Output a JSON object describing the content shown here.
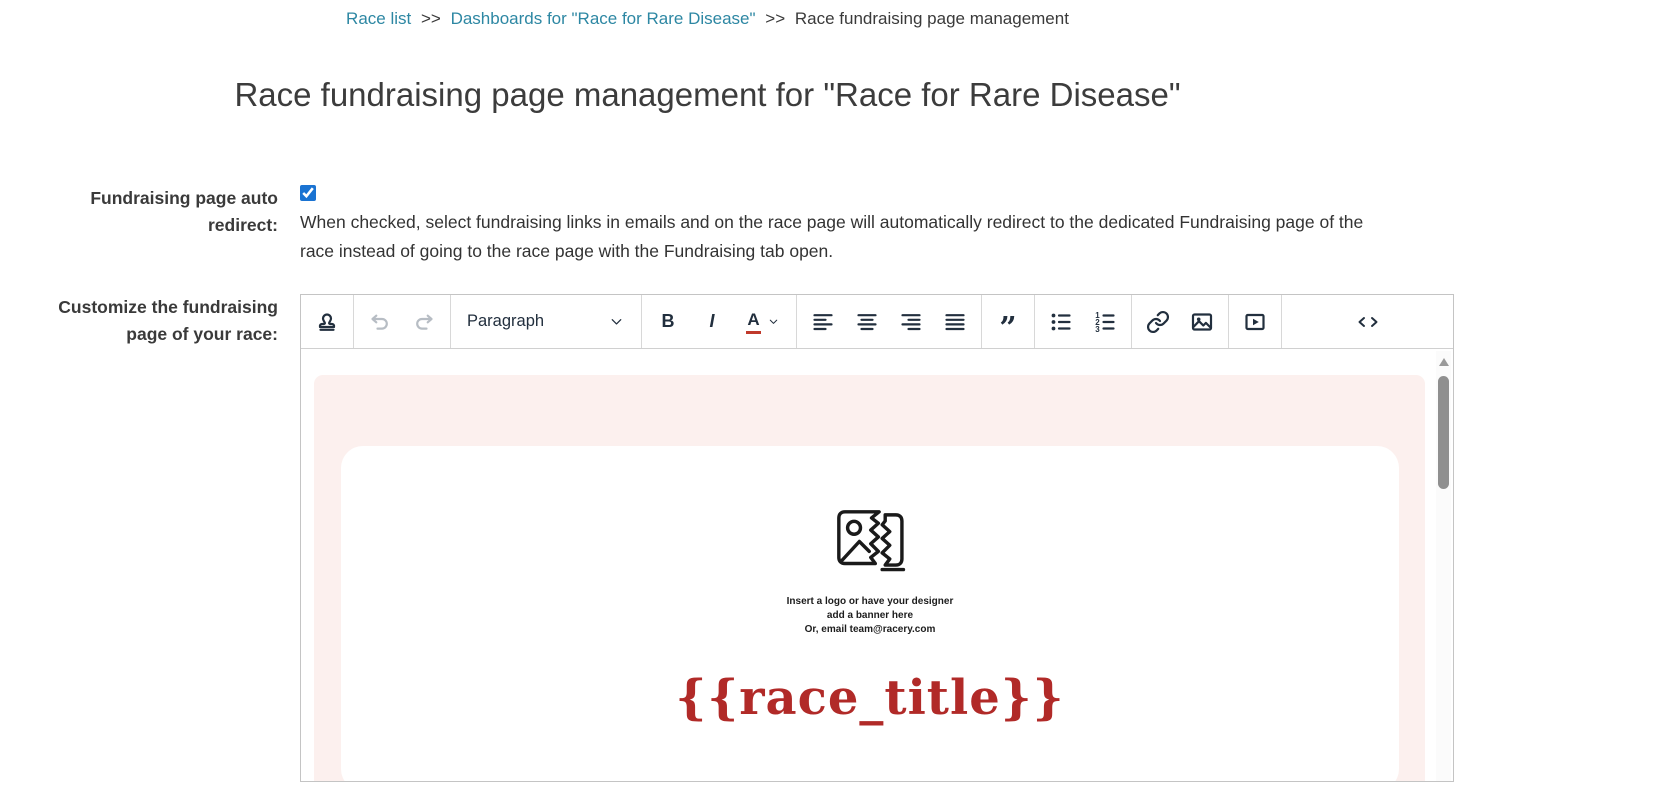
{
  "breadcrumb": {
    "separator": ">>",
    "items": [
      {
        "label": "Race list",
        "link": true
      },
      {
        "label": "Dashboards for \"Race for Rare Disease\"",
        "link": true
      },
      {
        "label": "Race fundraising page management",
        "link": false
      }
    ]
  },
  "page_title": "Race fundraising page management for \"Race for Rare Disease\"",
  "form": {
    "auto_redirect": {
      "label": "Fundraising page auto redirect:",
      "checked": true,
      "help_text": "When checked, select fundraising links in emails and on the race page will automatically redirect to the dedicated Fundraising page of the race instead of going to the race page with the Fundraising tab open."
    },
    "customize": {
      "label": "Customize the fundraising page of your race:"
    }
  },
  "editor": {
    "toolbar": {
      "paragraph_label": "Paragraph",
      "bold_label": "B",
      "italic_label": "I",
      "forecolor_label": "A",
      "blockquote_glyph": "”",
      "code_label": "<>",
      "buttons": [
        "merge-tag-stamp",
        "undo",
        "redo",
        "paragraph-format",
        "bold",
        "italic",
        "text-color",
        "align-left",
        "align-center",
        "align-right",
        "align-justify",
        "blockquote",
        "bullet-list",
        "numbered-list",
        "insert-link",
        "insert-image",
        "insert-media",
        "source-code"
      ]
    },
    "content": {
      "banner_caption_lines": [
        "Insert a logo or have your designer",
        "add a banner here",
        "Or, email team@racery.com"
      ],
      "race_title_placeholder": "{{race_title}}"
    }
  },
  "colors": {
    "link": "#2d87a3",
    "checkbox_accent": "#1a73d2",
    "toolbar_icon": "#222f3e",
    "content_pink": "#fcf0ee",
    "race_title_red": "#b12a28"
  }
}
